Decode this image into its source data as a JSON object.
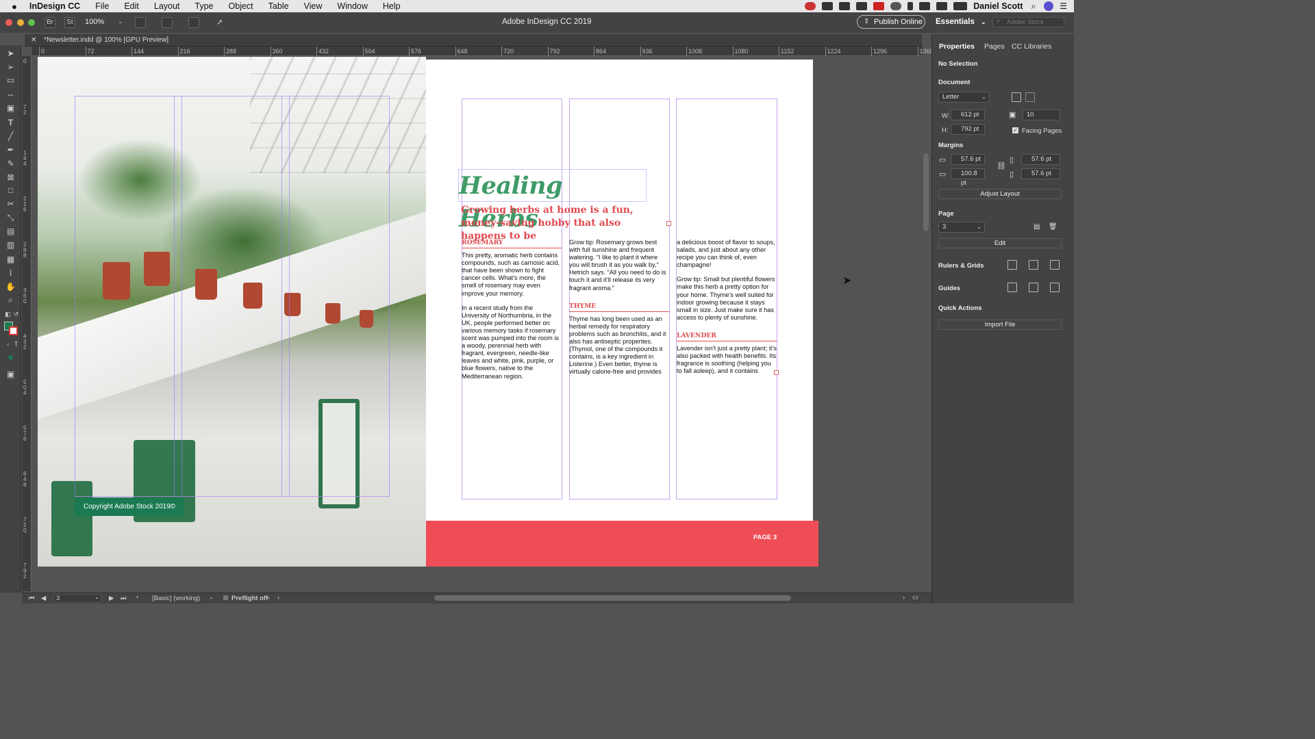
{
  "menubar": {
    "app": "InDesign CC",
    "items": [
      "File",
      "Edit",
      "Layout",
      "Type",
      "Object",
      "Table",
      "View",
      "Window",
      "Help"
    ],
    "user": "Daniel Scott"
  },
  "appbar": {
    "br": "Br",
    "st": "St",
    "zoom": "100%",
    "title": "Adobe InDesign CC 2019",
    "publish": "Publish Online",
    "workspace": "Essentials",
    "search_placeholder": "Adobe Stock"
  },
  "doctab": {
    "label": "*Newsletter.indd @ 100% [GPU Preview]"
  },
  "ruler": {
    "h": [
      "0",
      "72",
      "144",
      "216",
      "288",
      "360",
      "432",
      "504",
      "576",
      "648",
      "720",
      "792",
      "864",
      "936",
      "1008",
      "1080",
      "1152",
      "1224",
      "1296",
      "1368"
    ],
    "v": [
      "0",
      "72",
      "144",
      "216",
      "288",
      "360",
      "432",
      "504",
      "576",
      "648",
      "720",
      "792"
    ]
  },
  "spread": {
    "copyright": "Copyright Adobe Stock 2019©",
    "title": "Healing Herbs",
    "subtitle": "Growing herbs at home is a fun, money-saving hobby that also happens to be",
    "col1": {
      "head": "ROSEMARY",
      "p1": "This pretty, aromatic herb contains compounds, such as carnosic acid, that have been shown to fight cancer cells. What’s more, the smell of rosemary may even improve your memory.",
      "p2": "In a recent study from the University of Northumbria, in the UK, people performed better on various memory tasks if rosemary scent was pumped into the room is a woody, perennial herb with fragrant, evergreen, needle-like leaves and white, pink, purple, or blue flowers, native to the Mediterranean region."
    },
    "col2": {
      "p1": "Grow tip: Rosemary grows best with full sunshine and frequent watering. “I like to plant it where you will brush it as you walk by,” Hetrich says. “All you need to do is touch it and it’ll release its very fragrant aroma.”",
      "head": "THYME",
      "p2": "Thyme has long been used as an herbal remedy for respiratory problems such as bronchitis, and it also has antiseptic properties. (Thymol, one of the compounds it contains, is a key ingredient in Listerine.) Even better, thyme is virtually calorie-free and provides"
    },
    "col3": {
      "p1": "a delicious boost of flavor to soups, salads, and just about any other recipe you can think of, even champagne!",
      "p2": "Grow tip: Small but plentiful flowers make this herb a pretty option for your home. Thyme’s well suited for indoor growing because it stays small in size. Just make sure it has access to plenty of sunshine.",
      "head": "LAVENDER",
      "p3": "Lavender isn’t just a pretty plant; it’s also packed with health benefits. Its fragrance is soothing (helping you to fall asleep), and it contains"
    },
    "page_label": "PAGE 3"
  },
  "panel": {
    "tabs": [
      "Properties",
      "Pages",
      "CC Libraries"
    ],
    "selection": "No Selection",
    "document": "Document",
    "preset": "Letter",
    "w_label": "W:",
    "w": "612 pt",
    "h_label": "H:",
    "h": "792 pt",
    "pages": "10",
    "facing": "Facing Pages",
    "margins": "Margins",
    "m_top": "57.6 pt",
    "m_bottom": "100.8 pt",
    "m_left": "57.6 pt",
    "m_right": "57.6 pt",
    "adjust": "Adjust Layout",
    "page": "Page",
    "page_val": "3",
    "edit": "Edit",
    "rulers": "Rulers & Grids",
    "guides": "Guides",
    "quick": "Quick Actions",
    "import": "Import File"
  },
  "status": {
    "page": "3",
    "profile": "[Basic] (working)",
    "preflight": "Preflight off"
  },
  "colors": {
    "accent_green": "#3f9b67",
    "accent_red": "#e04a50",
    "footer_red": "#ef4d56"
  }
}
